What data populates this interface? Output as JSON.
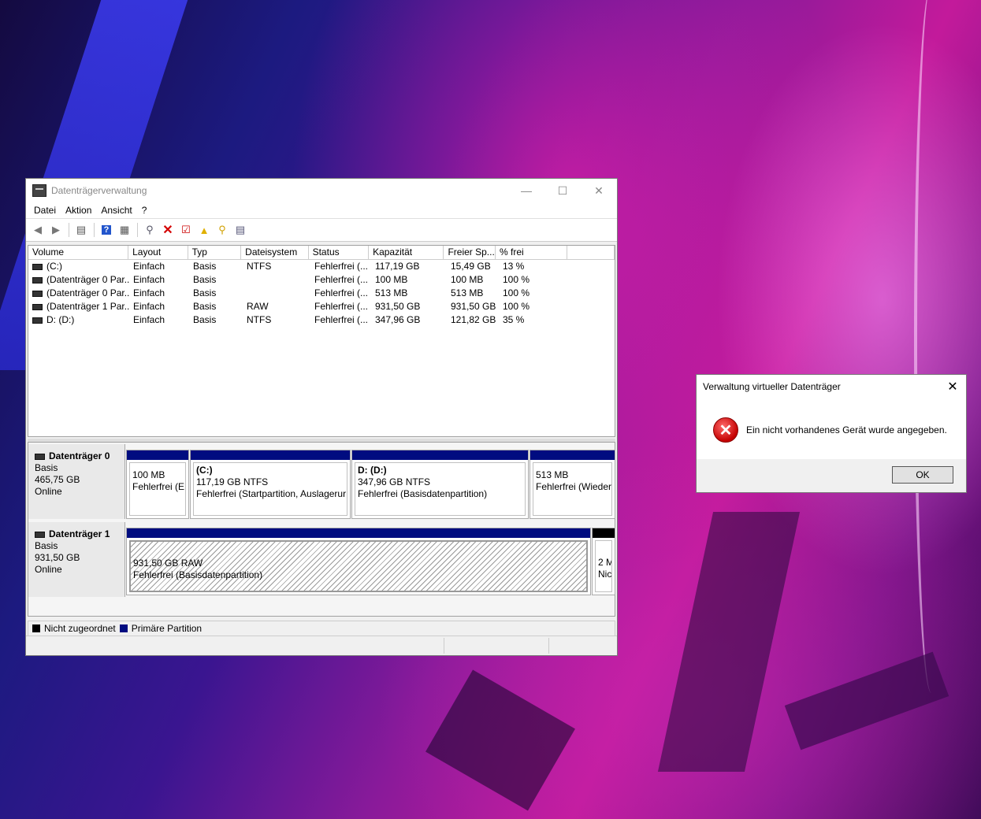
{
  "window": {
    "title": "Datenträgerverwaltung"
  },
  "menu": [
    "Datei",
    "Aktion",
    "Ansicht",
    "?"
  ],
  "toolbar_icons": [
    "back-arrow-icon",
    "forward-arrow-icon",
    "list-view-icon",
    "help-icon",
    "properties-icon",
    "connect-icon",
    "delete-icon",
    "check-icon",
    "folder-up-icon",
    "search-folder-icon",
    "settings-icon"
  ],
  "volumes": {
    "headers": [
      "Volume",
      "Layout",
      "Typ",
      "Dateisystem",
      "Status",
      "Kapazität",
      "Freier Sp...",
      "% frei",
      ""
    ],
    "rows": [
      [
        "(C:)",
        "Einfach",
        "Basis",
        "NTFS",
        "Fehlerfrei (...",
        "117,19 GB",
        "15,49 GB",
        "13 %"
      ],
      [
        "(Datenträger 0 Par...",
        "Einfach",
        "Basis",
        "",
        "Fehlerfrei (...",
        "100 MB",
        "100 MB",
        "100 %"
      ],
      [
        "(Datenträger 0 Par...",
        "Einfach",
        "Basis",
        "",
        "Fehlerfrei (...",
        "513 MB",
        "513 MB",
        "100 %"
      ],
      [
        "(Datenträger 1 Par...",
        "Einfach",
        "Basis",
        "RAW",
        "Fehlerfrei (...",
        "931,50 GB",
        "931,50 GB",
        "100 %"
      ],
      [
        "D: (D:)",
        "Einfach",
        "Basis",
        "NTFS",
        "Fehlerfrei (...",
        "347,96 GB",
        "121,82 GB",
        "35 %"
      ]
    ]
  },
  "disk0": {
    "name": "Datenträger 0",
    "type": "Basis",
    "size": "465,75 GB",
    "status": "Online",
    "p1": {
      "line1": "100 MB",
      "line2": "Fehlerfrei (EF"
    },
    "p2": {
      "title": "(C:)",
      "line1": "117,19 GB NTFS",
      "line2": "Fehlerfrei (Startpartition, Auslagerur"
    },
    "p3": {
      "title": "D:  (D:)",
      "line1": "347,96 GB NTFS",
      "line2": "Fehlerfrei (Basisdatenpartition)"
    },
    "p4": {
      "line1": "513 MB",
      "line2": "Fehlerfrei (Wiederl"
    }
  },
  "disk1": {
    "name": "Datenträger 1",
    "type": "Basis",
    "size": "931,50 GB",
    "status": "Online",
    "p1": {
      "line1": "931,50 GB RAW",
      "line2": "Fehlerfrei (Basisdatenpartition)"
    },
    "p2": {
      "line1": "2 M",
      "line2": "Nic"
    }
  },
  "legend": {
    "unallocated": "Nicht zugeordnet",
    "primary": "Primäre Partition",
    "unallocated_color": "#000000",
    "primary_color": "#000c80"
  },
  "dialog": {
    "title": "Verwaltung virtueller Datenträger",
    "message": "Ein nicht vorhandenes Gerät wurde angegeben.",
    "ok": "OK"
  }
}
